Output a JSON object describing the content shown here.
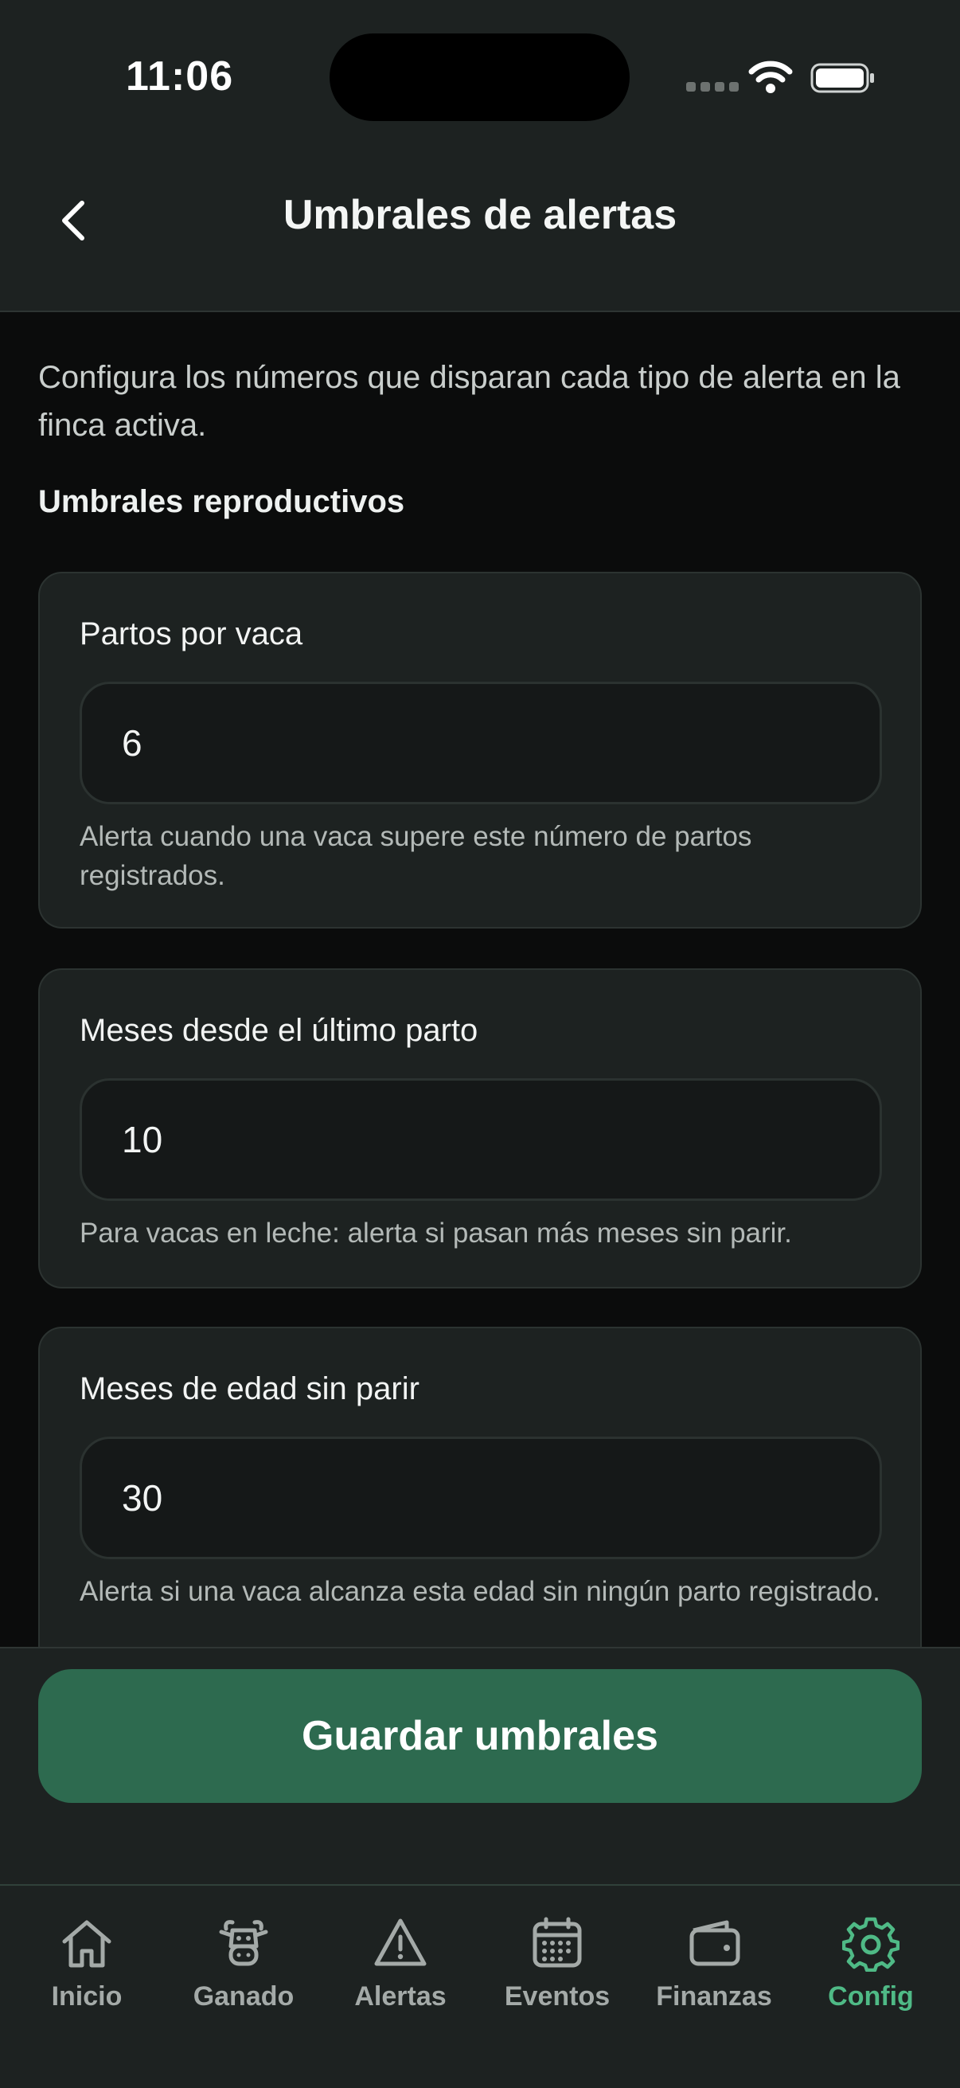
{
  "status_bar": {
    "time": "11:06"
  },
  "header": {
    "title": "Umbrales de alertas"
  },
  "intro": "Configura los números que disparan cada tipo de alerta en la finca activa.",
  "section_title": "Umbrales reproductivos",
  "cards": [
    {
      "label": "Partos por vaca",
      "value": "6",
      "help": "Alerta cuando una vaca supere este número de partos registrados."
    },
    {
      "label": "Meses desde el último parto",
      "value": "10",
      "help": "Para vacas en leche: alerta si pasan más meses sin parir."
    },
    {
      "label": "Meses de edad sin parir",
      "value": "30",
      "help": "Alerta si una vaca alcanza esta edad sin ningún parto registrado."
    }
  ],
  "save_button": "Guardar umbrales",
  "tabs": [
    {
      "label": "Inicio",
      "icon": "home-icon"
    },
    {
      "label": "Ganado",
      "icon": "cow-icon"
    },
    {
      "label": "Alertas",
      "icon": "warning-icon"
    },
    {
      "label": "Eventos",
      "icon": "calendar-icon"
    },
    {
      "label": "Finanzas",
      "icon": "wallet-icon"
    },
    {
      "label": "Config",
      "icon": "gear-icon",
      "active": true
    }
  ],
  "colors": {
    "accent": "#4fba86",
    "primary_button": "#2d6a4f",
    "surface": "#1d2221",
    "background": "#0b0c0c"
  }
}
